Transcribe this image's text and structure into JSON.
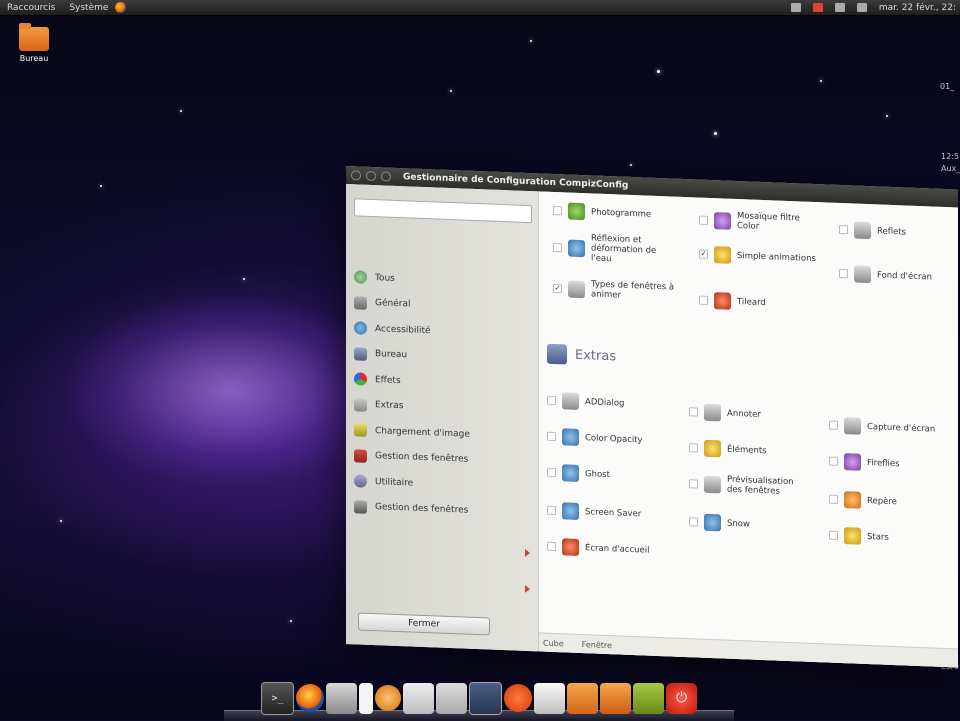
{
  "top_panel": {
    "menu_shortcuts": "Raccourcis",
    "menu_system": "Système",
    "clock": "mar. 22 févr., 22:"
  },
  "desktop": {
    "icon_label": "Bureau",
    "right_edge_texts": [
      "01_",
      "12:5",
      "Aux_",
      "23/0"
    ]
  },
  "window": {
    "title": "Gestionnaire de Configuration CompizConfig",
    "sidebar": {
      "categories": [
        {
          "label": "Tous",
          "icon": "all-icon"
        },
        {
          "label": "Général",
          "icon": "general-icon"
        },
        {
          "label": "Accessibilité",
          "icon": "accessibility-icon"
        },
        {
          "label": "Bureau",
          "icon": "desktop-icon"
        },
        {
          "label": "Effets",
          "icon": "effects-icon"
        },
        {
          "label": "Extras",
          "icon": "extras-icon"
        },
        {
          "label": "Chargement d'image",
          "icon": "image-loading-icon"
        },
        {
          "label": "Gestion des fenêtres",
          "icon": "window-management-icon"
        },
        {
          "label": "Utilitaire",
          "icon": "utility-icon"
        },
        {
          "label": "Gestion des fenêtres",
          "icon": "window-mgmt-icon"
        }
      ],
      "close_button": "Fermer"
    },
    "top_plugins": [
      {
        "label": "Photogramme",
        "checked": false
      },
      {
        "label": "Mosaïque filtre Color",
        "checked": false
      },
      {
        "label": "Reflets",
        "checked": false
      },
      {
        "label": "Réflexion et déformation de l'eau",
        "checked": false
      },
      {
        "label": "Simple animations",
        "checked": true
      },
      {
        "label": "Fond d'écran",
        "checked": false
      },
      {
        "label": "Types de fenêtres à animer",
        "checked": true
      },
      {
        "label": "Tileard",
        "checked": false
      }
    ],
    "extras_header": "Extras",
    "extras_plugins": [
      {
        "label": "ADDialog",
        "color": "c-grey"
      },
      {
        "label": "Annoter",
        "color": "c-grey"
      },
      {
        "label": "Capture d'écran",
        "color": "c-grey"
      },
      {
        "label": "Color Opacity",
        "color": "c-blue"
      },
      {
        "label": "Éléments",
        "color": "c-yellow"
      },
      {
        "label": "Fireflies",
        "color": "c-purple"
      },
      {
        "label": "Ghost",
        "color": "c-blue"
      },
      {
        "label": "Prévisualisation des fenêtres",
        "color": "c-grey"
      },
      {
        "label": "Repère",
        "color": "c-orange"
      },
      {
        "label": "Screen Saver",
        "color": "c-blue"
      },
      {
        "label": "Snow",
        "color": "c-blue"
      },
      {
        "label": "Stars",
        "color": "c-yellow"
      },
      {
        "label": "Écran d'accueil",
        "color": "c-red"
      }
    ],
    "bottom_labels": [
      "Cube",
      "Fenêtre"
    ]
  },
  "dock": {
    "launchers": [
      {
        "name": "terminal",
        "glyph": ">_"
      },
      {
        "name": "firefox",
        "glyph": ""
      },
      {
        "name": "calculator",
        "glyph": ""
      },
      {
        "name": "text-editor",
        "glyph": ""
      },
      {
        "name": "software-center",
        "glyph": ""
      },
      {
        "name": "file-manager",
        "glyph": ""
      },
      {
        "name": "mail",
        "glyph": ""
      },
      {
        "name": "screenshot",
        "glyph": ""
      },
      {
        "name": "ubuntu",
        "glyph": ""
      },
      {
        "name": "document",
        "glyph": ""
      },
      {
        "name": "folder",
        "glyph": ""
      },
      {
        "name": "folder-2",
        "glyph": ""
      },
      {
        "name": "tools",
        "glyph": ""
      },
      {
        "name": "power",
        "glyph": "⏻"
      }
    ]
  }
}
